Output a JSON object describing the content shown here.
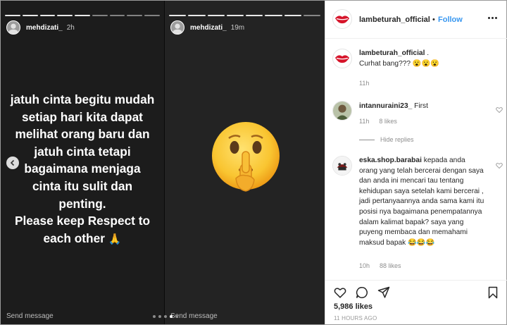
{
  "stories": {
    "left": {
      "username": "mehdizati_",
      "time": "2h",
      "text_lines": [
        "jatuh cinta begitu mudah",
        "setiap hari kita dapat",
        "melihat orang baru dan",
        "jatuh cinta tetapi",
        "bagaimana menjaga",
        "cinta itu sulit dan",
        "penting.",
        "Please keep Respect to",
        "each other"
      ],
      "emoji": "🙏",
      "send_message": "Send message"
    },
    "right": {
      "username": "mehdizati_",
      "time": "19m",
      "emoji_icon": "shushing-face-icon",
      "send_message": "Send message"
    }
  },
  "post": {
    "username": "lambeturah_official",
    "separator": "•",
    "follow_label": "Follow",
    "caption_user": "lambeturah_official",
    "caption_suffix": ".",
    "caption_text": "Curhat bang??? 😮😮😮",
    "caption_time": "11h",
    "comments": [
      {
        "user": "intannuraini23_",
        "text": "First",
        "time": "11h",
        "likes": "8 likes",
        "hide_replies": "Hide replies"
      },
      {
        "user": "eska.shop.barabai",
        "text": "kepada anda orang yang telah bercerai dengan saya dan anda ini mencari tau tentang kehidupan saya setelah kami bercerai , jadi pertanyaannya anda sama kami itu posisi nya bagaimana penempatannya dalam kalimat bapak? saya yang puyeng membaca dan memahami maksud bapak 😂😂😂",
        "time": "10h",
        "likes": "88 likes"
      }
    ],
    "likes_count": "5,986 likes",
    "posted_ago": "11 HOURS AGO"
  },
  "colors": {
    "accent": "#3897f0",
    "story_bg": "#1c1c1c",
    "lips_red": "#d6142a"
  }
}
